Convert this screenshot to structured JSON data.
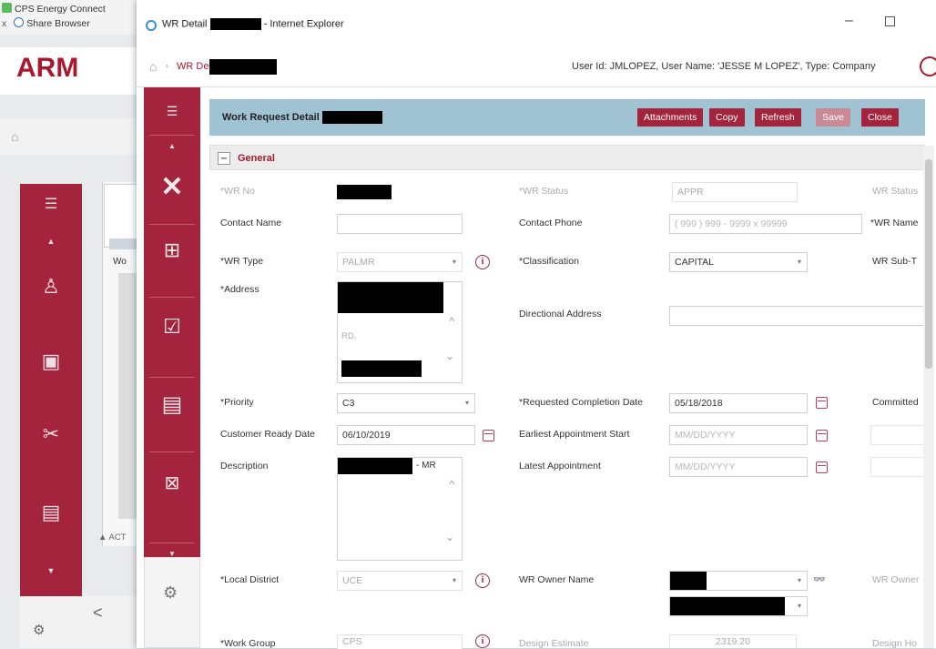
{
  "background_window": {
    "tabs": [
      {
        "label": "CPS Energy Connect",
        "icon": "app-icon"
      },
      {
        "label": "Share Browser",
        "icon": "search-icon"
      }
    ],
    "tab_close": "x",
    "logo": "ARM",
    "panel_fragment": "Wo",
    "action_label": "▲ ACT",
    "back_glyph": "<"
  },
  "window": {
    "title_prefix": "WR Detail",
    "title_suffix": "- Internet Explorer",
    "minimize": "–",
    "close": "✕"
  },
  "breadcrumb": {
    "label": "WR Detail",
    "separator": "›"
  },
  "user_info": "User Id: JMLOPEZ, User Name: 'JESSE M LOPEZ', Type: Company",
  "panel": {
    "title": "Work Request Detail",
    "buttons": {
      "attachments": "Attachments",
      "copy": "Copy",
      "refresh": "Refresh",
      "save": "Save",
      "close": "Close"
    }
  },
  "general": {
    "toggle": "–",
    "title": "General"
  },
  "fields": {
    "wr_no": {
      "label": "*WR No"
    },
    "wr_status": {
      "label": "*WR Status",
      "value": "APPR"
    },
    "wr_status_desc": {
      "label": "WR Status"
    },
    "contact_name": {
      "label": "Contact Name",
      "value": ""
    },
    "contact_phone": {
      "label": "Contact Phone",
      "value": "( 999 ) 999 - 9999  x  99999"
    },
    "wr_name": {
      "label": "*WR Name"
    },
    "wr_type": {
      "label": "*WR Type",
      "value": "PALMR"
    },
    "classification": {
      "label": "*Classification",
      "value": "CAPITAL"
    },
    "wr_sub_type": {
      "label": "WR Sub-T"
    },
    "address": {
      "label": "*Address",
      "value": "RD."
    },
    "directional_address": {
      "label": "Directional Address",
      "value": ""
    },
    "priority": {
      "label": "*Priority",
      "value": "C3"
    },
    "requested_completion": {
      "label": "*Requested Completion Date",
      "value": "05/18/2018"
    },
    "committed": {
      "label": "Committed"
    },
    "customer_ready": {
      "label": "Customer Ready Date",
      "value": "06/10/2019"
    },
    "earliest_appt": {
      "label": "Earliest Appointment Start",
      "placeholder": "MM/DD/YYYY"
    },
    "description": {
      "label": "Description",
      "value": "- MR"
    },
    "latest_appt": {
      "label": "Latest Appointment",
      "placeholder": "MM/DD/YYYY"
    },
    "local_district": {
      "label": "*Local District",
      "value": "UCE"
    },
    "wr_owner_name": {
      "label": "WR Owner Name"
    },
    "wr_owner": {
      "label": "WR Owner"
    },
    "work_group": {
      "label": "*Work Group",
      "value": "CPS"
    },
    "design_estimate": {
      "label": "Design Estimate",
      "value": "2319.20"
    },
    "design_ho": {
      "label": "Design Ho"
    }
  },
  "icons": {
    "info": "i",
    "binoculars": "👓",
    "dropdown": "▾"
  }
}
